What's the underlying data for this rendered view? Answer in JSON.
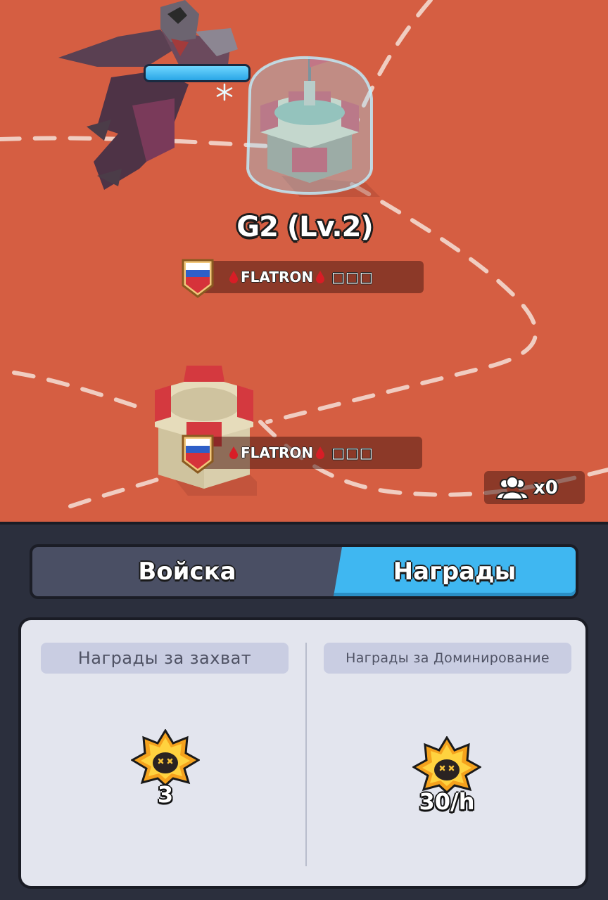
{
  "map": {
    "tower_title": "G2 (Lv.2)",
    "enemy_health_pct": 100,
    "owners": [
      {
        "flag": "russia",
        "name": "FLATRON",
        "suffix": "□□□"
      },
      {
        "flag": "russia",
        "name": "FLATRON",
        "suffix": "□□□"
      }
    ],
    "troops_count": "x0"
  },
  "tabs": {
    "troops_label": "Войска",
    "rewards_label": "Награды",
    "active": "rewards"
  },
  "rewards": {
    "capture": {
      "header": "Награды за захват",
      "value": "3"
    },
    "domination": {
      "header": "Награды за Доминирование",
      "value": "30/h"
    }
  },
  "colors": {
    "ground": "#d55e42",
    "panel": "#2b2f3d",
    "tab_active": "#3fb7f1",
    "tab_inactive": "#4a4f64",
    "card": "#e3e5ee",
    "tower_roof": "#d63c45",
    "health": "#2aa6e6"
  },
  "icons": [
    "enemy-dragon-rider",
    "snowflake-icon",
    "tower-icon",
    "russia-flag-shield-icon",
    "blood-drop-icon",
    "troops-icon",
    "skull-badge-icon"
  ]
}
